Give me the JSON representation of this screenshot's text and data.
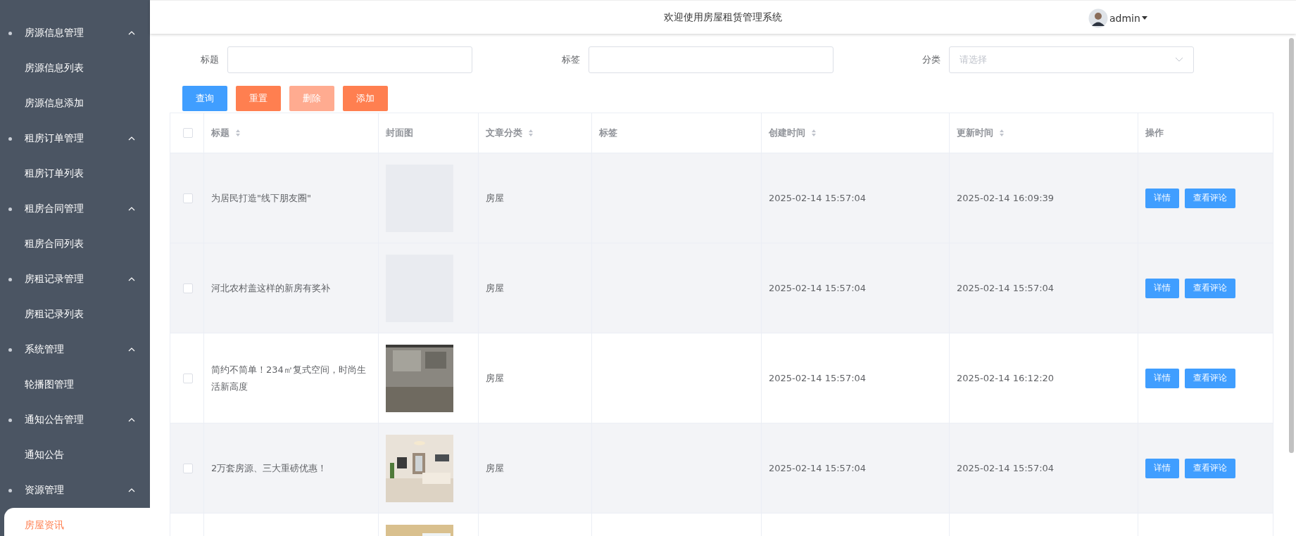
{
  "sidebar": {
    "groups": [
      {
        "label": "房源信息管理",
        "expanded": true,
        "children": [
          {
            "label": "房源信息列表",
            "selected": false
          },
          {
            "label": "房源信息添加",
            "selected": false
          }
        ]
      },
      {
        "label": "租房订单管理",
        "expanded": true,
        "children": [
          {
            "label": "租房订单列表",
            "selected": false
          }
        ]
      },
      {
        "label": "租房合同管理",
        "expanded": true,
        "children": [
          {
            "label": "租房合同列表",
            "selected": false
          }
        ]
      },
      {
        "label": "房租记录管理",
        "expanded": true,
        "children": [
          {
            "label": "房租记录列表",
            "selected": false
          }
        ]
      },
      {
        "label": "系统管理",
        "expanded": true,
        "children": [
          {
            "label": "轮播图管理",
            "selected": false
          }
        ]
      },
      {
        "label": "通知公告管理",
        "expanded": true,
        "children": [
          {
            "label": "通知公告",
            "selected": false
          }
        ]
      },
      {
        "label": "资源管理",
        "expanded": true,
        "children": [
          {
            "label": "房屋资讯",
            "selected": true
          }
        ]
      }
    ]
  },
  "header": {
    "title": "欢迎使用房屋租赁管理系统",
    "user": "admin"
  },
  "filters": [
    {
      "label": "标题",
      "kind": "text"
    },
    {
      "label": "标签",
      "kind": "text"
    },
    {
      "label": "分类",
      "kind": "select",
      "placeholder": "请选择"
    }
  ],
  "actions": [
    {
      "label": "查询",
      "kind": "primary",
      "disabled": false
    },
    {
      "label": "重置",
      "kind": "warning",
      "disabled": false
    },
    {
      "label": "删除",
      "kind": "warning",
      "disabled": true
    },
    {
      "label": "添加",
      "kind": "warning",
      "disabled": false
    }
  ],
  "table": {
    "all_checked": false,
    "columns": [
      {
        "label": "标题",
        "sortable": true
      },
      {
        "label": "封面图",
        "sortable": false
      },
      {
        "label": "文章分类",
        "sortable": true
      },
      {
        "label": "标签",
        "sortable": false
      },
      {
        "label": "创建时间",
        "sortable": true
      },
      {
        "label": "更新时间",
        "sortable": true
      },
      {
        "label": "操作",
        "sortable": false
      }
    ],
    "rows": [
      {
        "checked": false,
        "highlighted": true,
        "title": "为居民打造\"线下朋友圈\"",
        "cover": {
          "kind": "blank"
        },
        "category": "房屋",
        "created": "2025-02-14 15:57:04",
        "updated": "2025-02-14 16:09:39",
        "buttons": [
          "详情",
          "查看评论"
        ]
      },
      {
        "checked": false,
        "highlighted": true,
        "title": "河北农村盖这样的新房有奖补",
        "cover": {
          "kind": "blank"
        },
        "category": "房屋",
        "created": "2025-02-14 15:57:04",
        "updated": "2025-02-14 15:57:04",
        "buttons": [
          "详情",
          "查看评论"
        ]
      },
      {
        "checked": false,
        "highlighted": false,
        "title": "简约不简单！234㎡复式空间，时尚生活新高度",
        "cover": {
          "kind": "picture"
        },
        "category": "房屋",
        "created": "2025-02-14 15:57:04",
        "updated": "2025-02-14 16:12:20",
        "buttons": [
          "详情",
          "查看评论"
        ]
      },
      {
        "checked": false,
        "highlighted": true,
        "title": "2万套房源、三大重磅优惠！",
        "cover": {
          "kind": "picture"
        },
        "category": "房屋",
        "created": "2025-02-14 15:57:04",
        "updated": "2025-02-14 15:57:04",
        "buttons": [
          "详情",
          "查看评论"
        ]
      }
    ],
    "partial_row": {
      "cover": {
        "kind": "picture"
      }
    }
  }
}
